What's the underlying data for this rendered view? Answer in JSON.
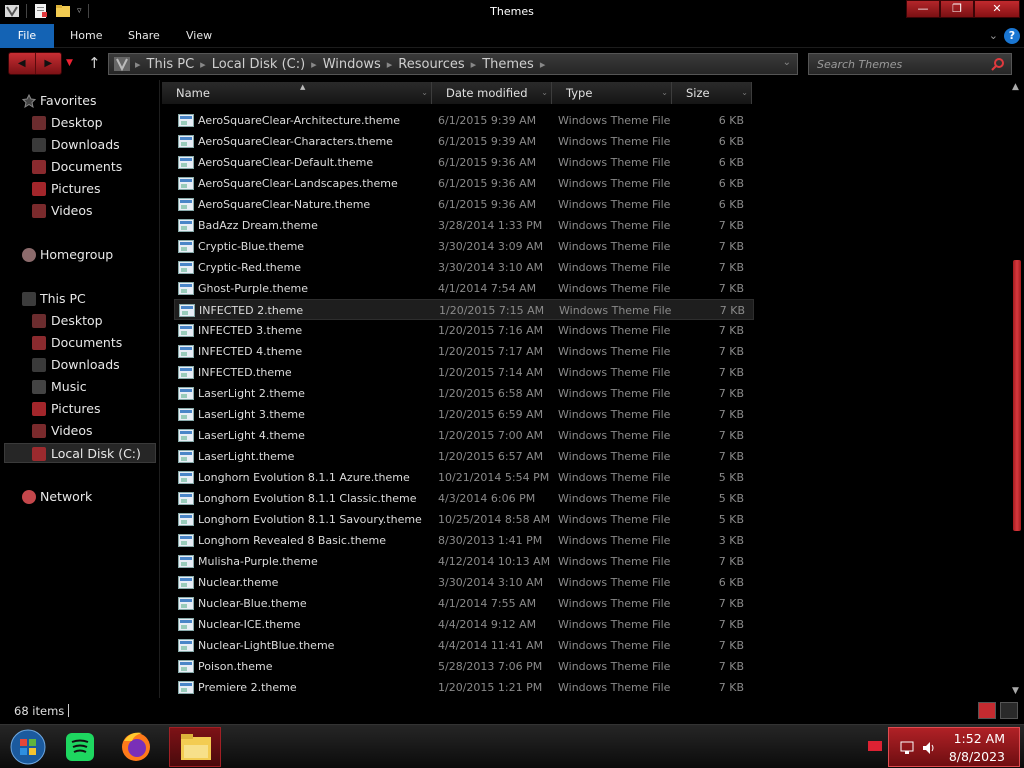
{
  "window": {
    "title": "Themes",
    "minimize": "—",
    "maximize": "❐",
    "close": "✕"
  },
  "ribbon": {
    "tabs": [
      "File",
      "Home",
      "Share",
      "View"
    ],
    "expand": "⌄",
    "help": "?"
  },
  "nav": {
    "back": "◀",
    "forward": "▶",
    "recent": "▼",
    "up": "↑"
  },
  "address": {
    "crumbs": [
      "This PC",
      "Local Disk (C:)",
      "Windows",
      "Resources",
      "Themes"
    ],
    "separator": "▸",
    "dropdown": "⌄"
  },
  "search": {
    "placeholder": "Search Themes"
  },
  "navpane": {
    "favorites": {
      "label": "Favorites",
      "items": [
        "Desktop",
        "Downloads",
        "Documents",
        "Pictures",
        "Videos"
      ]
    },
    "homegroup": {
      "label": "Homegroup"
    },
    "thispc": {
      "label": "This PC",
      "items": [
        "Desktop",
        "Documents",
        "Downloads",
        "Music",
        "Pictures",
        "Videos",
        "Local Disk (C:)"
      ]
    },
    "network": {
      "label": "Network"
    }
  },
  "columns": {
    "name": "Name",
    "date": "Date modified",
    "type": "Type",
    "size": "Size"
  },
  "files": [
    {
      "name": "AeroSquareClear-Architecture.theme",
      "date": "6/1/2015 9:39 AM",
      "type": "Windows Theme File",
      "size": "6 KB"
    },
    {
      "name": "AeroSquareClear-Characters.theme",
      "date": "6/1/2015 9:39 AM",
      "type": "Windows Theme File",
      "size": "6 KB"
    },
    {
      "name": "AeroSquareClear-Default.theme",
      "date": "6/1/2015 9:36 AM",
      "type": "Windows Theme File",
      "size": "6 KB"
    },
    {
      "name": "AeroSquareClear-Landscapes.theme",
      "date": "6/1/2015 9:36 AM",
      "type": "Windows Theme File",
      "size": "6 KB"
    },
    {
      "name": "AeroSquareClear-Nature.theme",
      "date": "6/1/2015 9:36 AM",
      "type": "Windows Theme File",
      "size": "6 KB"
    },
    {
      "name": "BadAzz Dream.theme",
      "date": "3/28/2014 1:33 PM",
      "type": "Windows Theme File",
      "size": "7 KB"
    },
    {
      "name": "Cryptic-Blue.theme",
      "date": "3/30/2014 3:09 AM",
      "type": "Windows Theme File",
      "size": "7 KB"
    },
    {
      "name": "Cryptic-Red.theme",
      "date": "3/30/2014 3:10 AM",
      "type": "Windows Theme File",
      "size": "7 KB"
    },
    {
      "name": "Ghost-Purple.theme",
      "date": "4/1/2014 7:54 AM",
      "type": "Windows Theme File",
      "size": "7 KB"
    },
    {
      "name": "INFECTED 2.theme",
      "date": "1/20/2015 7:15 AM",
      "type": "Windows Theme File",
      "size": "7 KB"
    },
    {
      "name": "INFECTED 3.theme",
      "date": "1/20/2015 7:16 AM",
      "type": "Windows Theme File",
      "size": "7 KB"
    },
    {
      "name": "INFECTED 4.theme",
      "date": "1/20/2015 7:17 AM",
      "type": "Windows Theme File",
      "size": "7 KB"
    },
    {
      "name": "INFECTED.theme",
      "date": "1/20/2015 7:14 AM",
      "type": "Windows Theme File",
      "size": "7 KB"
    },
    {
      "name": "LaserLight 2.theme",
      "date": "1/20/2015 6:58 AM",
      "type": "Windows Theme File",
      "size": "7 KB"
    },
    {
      "name": "LaserLight 3.theme",
      "date": "1/20/2015 6:59 AM",
      "type": "Windows Theme File",
      "size": "7 KB"
    },
    {
      "name": "LaserLight 4.theme",
      "date": "1/20/2015 7:00 AM",
      "type": "Windows Theme File",
      "size": "7 KB"
    },
    {
      "name": "LaserLight.theme",
      "date": "1/20/2015 6:57 AM",
      "type": "Windows Theme File",
      "size": "7 KB"
    },
    {
      "name": "Longhorn Evolution 8.1.1 Azure.theme",
      "date": "10/21/2014 5:54 PM",
      "type": "Windows Theme File",
      "size": "5 KB"
    },
    {
      "name": "Longhorn Evolution 8.1.1 Classic.theme",
      "date": "4/3/2014 6:06 PM",
      "type": "Windows Theme File",
      "size": "5 KB"
    },
    {
      "name": "Longhorn Evolution 8.1.1 Savoury.theme",
      "date": "10/25/2014 8:58 AM",
      "type": "Windows Theme File",
      "size": "5 KB"
    },
    {
      "name": "Longhorn Revealed 8 Basic.theme",
      "date": "8/30/2013 1:41 PM",
      "type": "Windows Theme File",
      "size": "3 KB"
    },
    {
      "name": "Mulisha-Purple.theme",
      "date": "4/12/2014 10:13 AM",
      "type": "Windows Theme File",
      "size": "7 KB"
    },
    {
      "name": "Nuclear.theme",
      "date": "3/30/2014 3:10 AM",
      "type": "Windows Theme File",
      "size": "6 KB"
    },
    {
      "name": "Nuclear-Blue.theme",
      "date": "4/1/2014 7:55 AM",
      "type": "Windows Theme File",
      "size": "7 KB"
    },
    {
      "name": "Nuclear-ICE.theme",
      "date": "4/4/2014 9:12 AM",
      "type": "Windows Theme File",
      "size": "7 KB"
    },
    {
      "name": "Nuclear-LightBlue.theme",
      "date": "4/4/2014 11:41 AM",
      "type": "Windows Theme File",
      "size": "7 KB"
    },
    {
      "name": "Poison.theme",
      "date": "5/28/2013 7:06 PM",
      "type": "Windows Theme File",
      "size": "7 KB"
    },
    {
      "name": "Premiere 2.theme",
      "date": "1/20/2015 1:21 PM",
      "type": "Windows Theme File",
      "size": "7 KB"
    }
  ],
  "hovered_index": 9,
  "scroll": {
    "position": 0.52,
    "visible_fraction": 0.46
  },
  "status": {
    "count": "68 items"
  },
  "taskbar": {
    "time": "1:52 AM",
    "date": "8/8/2023"
  },
  "colors": {
    "accent": "#c42b30",
    "file_tab": "#1463b4",
    "text": "#dcdcdc",
    "muted": "#8a8a8a"
  },
  "icons": [
    "explorer-icon",
    "properties-icon",
    "new-folder-icon",
    "search-icon",
    "theme-file-icon",
    "star-icon",
    "homegroup-icon",
    "computer-icon",
    "network-icon",
    "windows-start-icon",
    "spotify-icon",
    "firefox-icon",
    "file-explorer-icon",
    "network-tray-icon",
    "volume-icon"
  ]
}
